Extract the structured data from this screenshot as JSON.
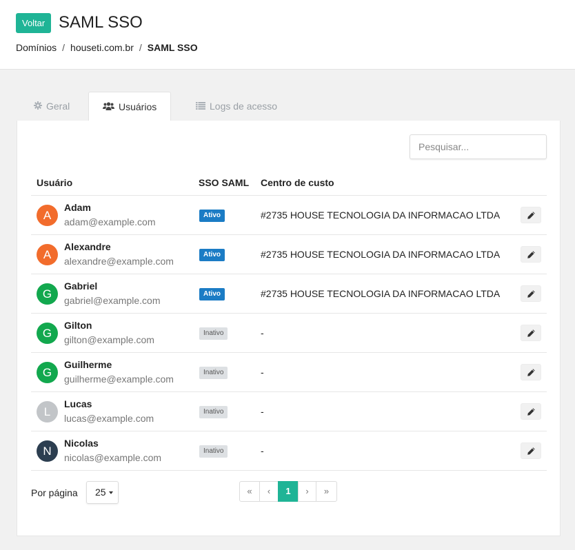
{
  "header": {
    "back_label": "Voltar",
    "title": "SAML SSO",
    "breadcrumb": [
      "Domínios",
      "houseti.com.br",
      "SAML SSO"
    ]
  },
  "tabs": [
    {
      "label": "Geral",
      "icon": "gear-icon",
      "active": false
    },
    {
      "label": "Usuários",
      "icon": "users-icon",
      "active": true
    },
    {
      "label": "Logs de acesso",
      "icon": "list-icon",
      "active": false
    }
  ],
  "search": {
    "placeholder": "Pesquisar...",
    "value": ""
  },
  "table": {
    "columns": [
      "Usuário",
      "SSO SAML",
      "Centro de custo"
    ],
    "rows": [
      {
        "initial": "A",
        "avatar_color": "#f26c2c",
        "name": "Adam",
        "email": "adam@example.com",
        "sso": "Ativo",
        "sso_active": true,
        "cost_center": "#2735 HOUSE TECNOLOGIA DA INFORMACAO LTDA"
      },
      {
        "initial": "A",
        "avatar_color": "#f26c2c",
        "name": "Alexandre",
        "email": "alexandre@example.com",
        "sso": "Ativo",
        "sso_active": true,
        "cost_center": "#2735 HOUSE TECNOLOGIA DA INFORMACAO LTDA"
      },
      {
        "initial": "G",
        "avatar_color": "#12a84e",
        "name": "Gabriel",
        "email": "gabriel@example.com",
        "sso": "Ativo",
        "sso_active": true,
        "cost_center": "#2735 HOUSE TECNOLOGIA DA INFORMACAO LTDA"
      },
      {
        "initial": "G",
        "avatar_color": "#12a84e",
        "name": "Gilton",
        "email": "gilton@example.com",
        "sso": "Inativo",
        "sso_active": false,
        "cost_center": "-"
      },
      {
        "initial": "G",
        "avatar_color": "#12a84e",
        "name": "Guilherme",
        "email": "guilherme@example.com",
        "sso": "Inativo",
        "sso_active": false,
        "cost_center": "-"
      },
      {
        "initial": "L",
        "avatar_color": "#c2c5c8",
        "name": "Lucas",
        "email": "lucas@example.com",
        "sso": "Inativo",
        "sso_active": false,
        "cost_center": "-"
      },
      {
        "initial": "N",
        "avatar_color": "#2c3e50",
        "name": "Nicolas",
        "email": "nicolas@example.com",
        "sso": "Inativo",
        "sso_active": false,
        "cost_center": "-"
      }
    ]
  },
  "footer": {
    "per_page_label": "Por página",
    "per_page_value": "25",
    "pagination": {
      "first": "«",
      "prev": "‹",
      "current": "1",
      "next": "›",
      "last": "»"
    }
  },
  "colors": {
    "accent": "#1fb496",
    "active_badge": "#1b7cc5",
    "inactive_badge": "#dde0e3"
  }
}
